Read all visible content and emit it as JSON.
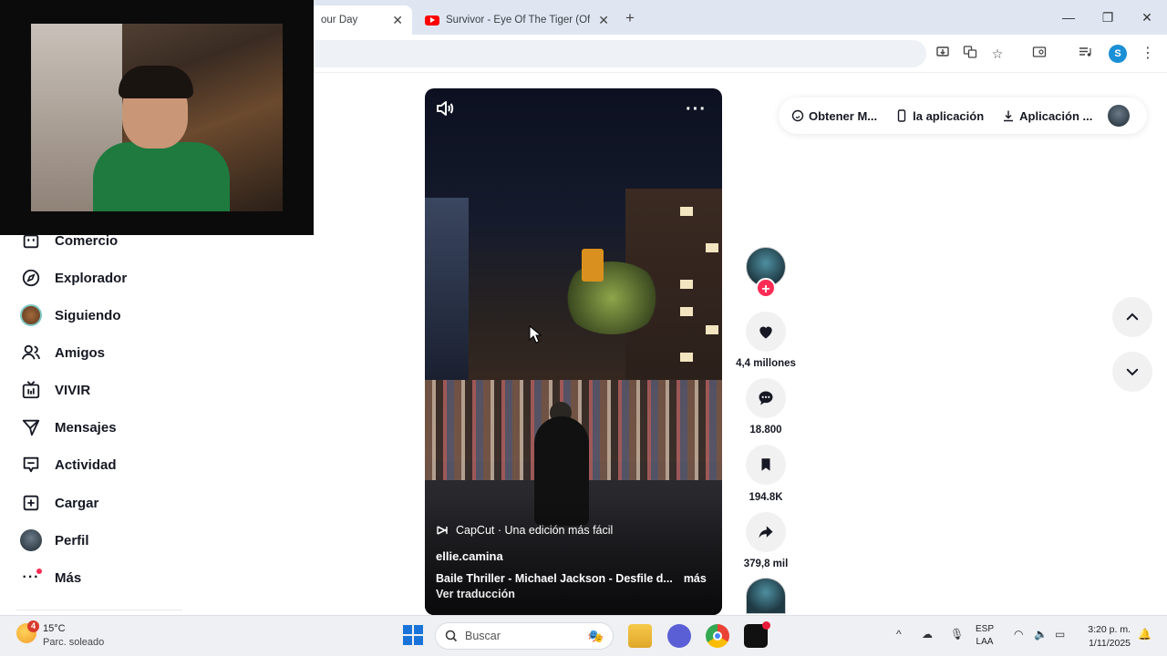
{
  "browser": {
    "tabs": [
      {
        "title": "our Day",
        "active": true
      },
      {
        "title": "Survivor - Eye Of The Tiger (Off",
        "active": false
      }
    ],
    "new_tab_label": "+",
    "window_buttons": [
      "—",
      "❐",
      "✕"
    ],
    "profile_initial": "S"
  },
  "sidebar": {
    "items": [
      {
        "label": "Comercio",
        "icon": "shop-icon"
      },
      {
        "label": "Explorador",
        "icon": "compass-icon"
      },
      {
        "label": "Siguiendo",
        "icon": "avatar"
      },
      {
        "label": "Amigos",
        "icon": "friends-icon"
      },
      {
        "label": "VIVIR",
        "icon": "live-tv-icon"
      },
      {
        "label": "Mensajes",
        "icon": "send-icon"
      },
      {
        "label": "Actividad",
        "icon": "activity-icon"
      },
      {
        "label": "Cargar",
        "icon": "upload-plus-icon"
      },
      {
        "label": "Perfil",
        "icon": "avatar"
      },
      {
        "label": "Más",
        "icon": "more-dots-icon"
      }
    ]
  },
  "top_actions": {
    "items": [
      "Obtener M...",
      "la aplicación",
      "Aplicación ..."
    ]
  },
  "video": {
    "capcut_label": "CapCut · Una edición más fácil",
    "author": "ellie.camina",
    "description": "Baile Thriller - Michael Jackson - Desfile d...",
    "more_label": "más",
    "translate_label": "Ver traducción"
  },
  "actions": {
    "likes": "4,4 millones",
    "comments": "18.800",
    "saves": "194.8K",
    "shares": "379,8 mil"
  },
  "taskbar": {
    "temperature": "15°C",
    "weather": "Parc. soleado",
    "weather_badge": "4",
    "search_placeholder": "Buscar",
    "lang_top": "ESP",
    "lang_bottom": "LAA",
    "time": "3:20 p. m.",
    "date": "1/11/2025"
  },
  "colors": {
    "accent": "#fe2c55",
    "tab_bar": "#dfe6f2",
    "youtube": "#ff0000"
  }
}
